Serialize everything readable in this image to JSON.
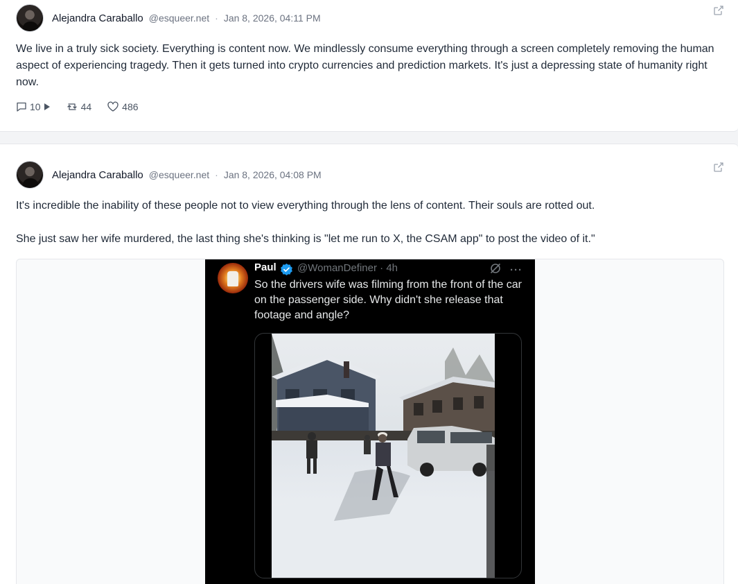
{
  "posts": [
    {
      "author": "Alejandra Caraballo",
      "handle": "@esqueer.net",
      "separator": "·",
      "timestamp": "Jan 8, 2026, 04:11 PM",
      "text": "We live in a truly sick society. Everything is content now. We mindlessly consume everything through a screen completely removing the human aspect of experiencing tragedy. Then it gets turned into crypto currencies and prediction markets. It's just a depressing state of humanity right now.",
      "replies": "10",
      "reposts": "44",
      "likes": "486"
    },
    {
      "author": "Alejandra Caraballo",
      "handle": "@esqueer.net",
      "separator": "·",
      "timestamp": "Jan 8, 2026, 04:08 PM",
      "paragraph1": "It's incredible the inability of these people not to view everything through the lens of content. Their souls are rotted out.",
      "paragraph2": "She just saw her wife murdered, the last thing she's thinking is \"let me run to X, the CSAM app\" to post the video of it.\"",
      "embed": {
        "name": "Paul",
        "handle_time": "@WomanDefiner · 4h",
        "more": "···",
        "text": "So the drivers wife was filming from the front of the car on the passenger side. Why didn't she release that footage and angle?"
      }
    }
  ],
  "colors": {
    "background": "#f3f4f6",
    "card": "#ffffff",
    "verified_badge": "#1d9bf0",
    "muted_text": "#6b7280"
  },
  "icons": [
    "external-link-icon",
    "reply-icon",
    "play-icon",
    "repost-icon",
    "heart-icon",
    "verified-badge-icon",
    "grok-icon",
    "more-icon"
  ]
}
